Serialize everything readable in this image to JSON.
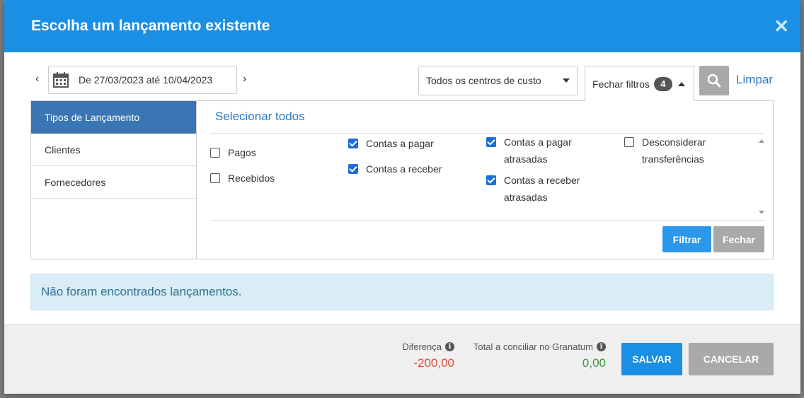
{
  "modal": {
    "title": "Escolha um lançamento existente",
    "close_icon": "close-icon"
  },
  "toolbar": {
    "prev_icon": "chevron-left-icon",
    "next_icon": "chevron-right-icon",
    "date_range": "De 27/03/2023 até 10/04/2023",
    "cost_center": "Todos os centros de custo",
    "filters_toggle": "Fechar filtros",
    "filters_count": "4",
    "clear_label": "Limpar"
  },
  "filters": {
    "categories": [
      "Tipos de Lançamento",
      "Clientes",
      "Fornecedores"
    ],
    "active_category": "Tipos de Lançamento",
    "select_all": "Selecionar todos",
    "options": [
      {
        "label": "Pagos",
        "checked": false
      },
      {
        "label": "Recebidos",
        "checked": false
      },
      {
        "label": "Contas a pagar",
        "checked": true
      },
      {
        "label": "Contas a receber",
        "checked": true
      },
      {
        "label": "Contas a pagar atrasadas",
        "checked": true
      },
      {
        "label": "Contas a receber atrasadas",
        "checked": true
      },
      {
        "label": "Desconsiderar transferências",
        "checked": false
      }
    ],
    "apply_label": "Filtrar",
    "close_label": "Fechar"
  },
  "alert": {
    "message": "Não foram encontrados lançamentos."
  },
  "footer": {
    "difference_label": "Diferença",
    "difference_value": "-200,00",
    "total_label": "Total a conciliar no Granatum",
    "total_value": "0,00",
    "save_label": "SALVAR",
    "cancel_label": "CANCELAR"
  },
  "colors": {
    "header": "#1a8fe3",
    "active_tab": "#3a76b4",
    "negative": "#e04b3a",
    "positive": "#3a9a3a"
  }
}
